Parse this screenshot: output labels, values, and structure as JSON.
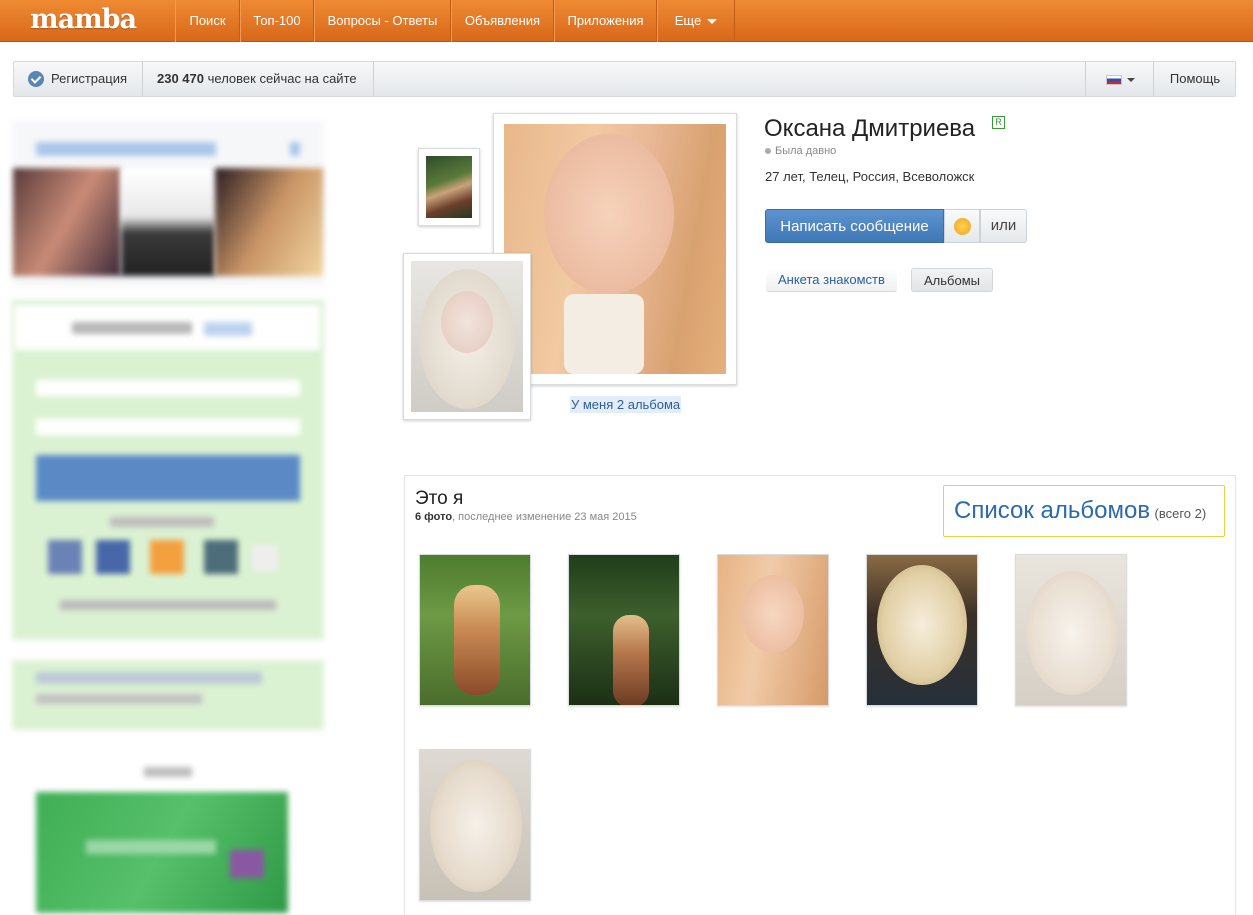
{
  "header": {
    "logo": "mamba",
    "nav": [
      {
        "label": "Поиск"
      },
      {
        "label": "Топ-100"
      },
      {
        "label": "Вопросы - Ответы"
      },
      {
        "label": "Объявления"
      },
      {
        "label": "Приложения"
      },
      {
        "label": "Еще"
      }
    ]
  },
  "subbar": {
    "register_label": "Регистрация",
    "online_count": "230 470",
    "online_text": "человек сейчас на сайте",
    "help_label": "Помощь"
  },
  "profile": {
    "name": "Оксана Дмитриева",
    "badge": "R",
    "status": "Была давно",
    "info": "27 лет, Телец, Россия, Всеволожск",
    "message_button": "Написать сообщение",
    "or_button": "или",
    "tabs": [
      {
        "label": "Анкета знакомств"
      },
      {
        "label": "Альбомы"
      }
    ],
    "albums_link": "У меня 2 альбома"
  },
  "album": {
    "title": "Это я",
    "photo_count": "6 фото",
    "last_change": ", последнее изменение 23 мая 2015",
    "list_title": "Список альбомов",
    "list_total": "(всего 2)"
  },
  "colors": {
    "brand_orange": "#e17623",
    "link_blue": "#2a5f9e",
    "button_blue": "#4a83c2",
    "highlight_yellow": "#f1cd45"
  }
}
